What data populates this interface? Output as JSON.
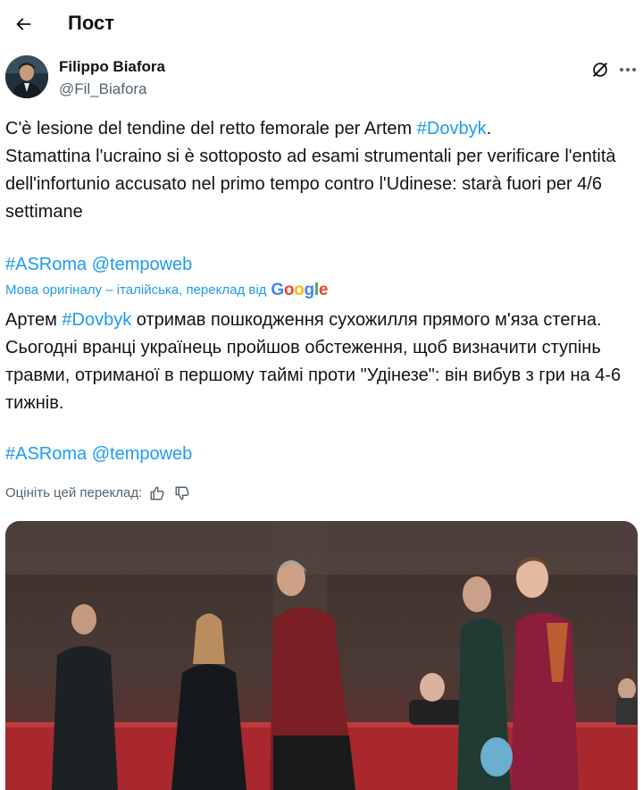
{
  "header": {
    "title": "Пост"
  },
  "author": {
    "name": "Filippo Biafora",
    "handle": "@Fil_Biafora"
  },
  "tweet": {
    "orig_before": "C'è lesione del tendine del retto femorale per Artem ",
    "orig_tag": "#Dovbyk",
    "orig_after": ".\nStamattina l'ucraino si è sottoposto ad esami strumentali per verificare l'entità dell'infortunio accusato nel primo tempo contro l'Udinese: starà fuori per 4/6 settimane",
    "tag_asroma": "#ASRoma",
    "mention": "@tempoweb",
    "translation_note": "Мова оригіналу – італійська, переклад від",
    "google_letters": [
      "G",
      "o",
      "o",
      "g",
      "l",
      "e"
    ],
    "tr_before": "Артем ",
    "tr_tag": "#Dovbyk",
    "tr_after": " отримав пошкодження сухожилля прямого м'яза стегна. Сьогодні вранці українець пройшов обстеження, щоб визначити ступінь травми, отриманої в першому таймі проти \"Удінезе\": він вибув з гри на 4-6 тижнів.",
    "rate_label": "Оцініть цей переклад:"
  },
  "colors": {
    "link": "#1d9bf0",
    "muted": "#536471",
    "text": "#0f1419"
  },
  "icons": [
    "back-arrow-icon",
    "grok-icon",
    "more-icon",
    "thumbs-up-icon",
    "thumbs-down-icon"
  ]
}
